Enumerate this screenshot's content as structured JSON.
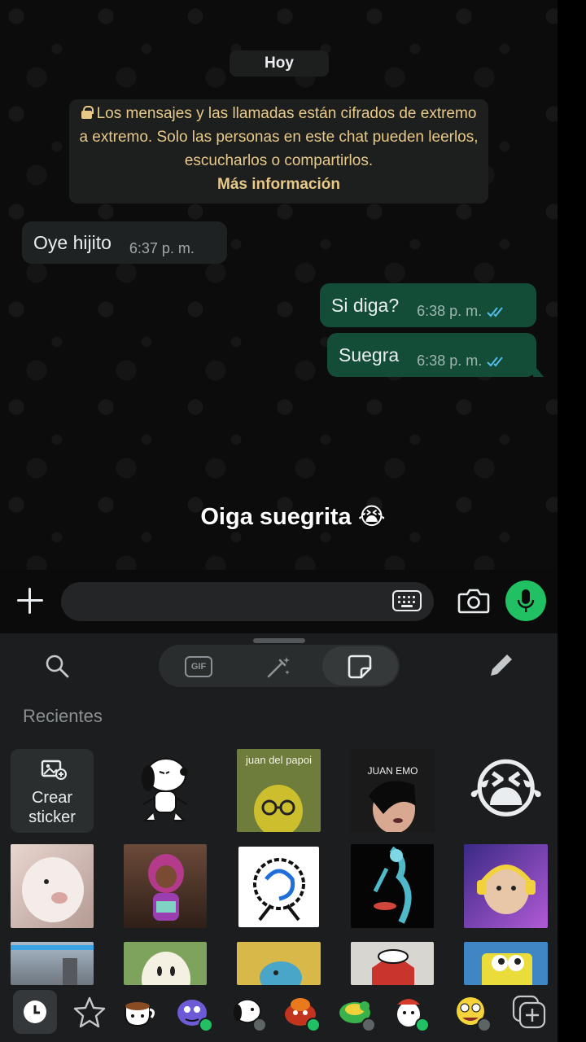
{
  "chat": {
    "date_chip": "Hoy",
    "encryption_notice": "Los mensajes y las llamadas están cifrados de extremo a extremo. Solo las personas en este chat pueden leerlos, escucharlos o compartirlos.",
    "encryption_more": "Más información",
    "messages": [
      {
        "direction": "incoming",
        "text": "Oye hijito",
        "time": "6:37 p. m."
      },
      {
        "direction": "outgoing",
        "text": "Si diga?",
        "time": "6:38 p. m.",
        "status": "read"
      },
      {
        "direction": "outgoing",
        "text": "Suegra",
        "time": "6:38 p. m.",
        "status": "read"
      }
    ]
  },
  "caption": "Oiga suegrita 😭",
  "input_bar": {
    "placeholder": "",
    "icons": [
      "plus-icon",
      "keyboard-icon",
      "camera-icon",
      "microphone-icon"
    ]
  },
  "sticker_panel": {
    "tabs": [
      "GIF",
      "avatar",
      "sticker"
    ],
    "active_tab": "sticker",
    "section_label": "Recientes",
    "create_sticker_label": "Crear sticker",
    "stickers": [
      {
        "id": "snoopy-sticker"
      },
      {
        "id": "juan-del-papoi-sticker",
        "text": "juan del papoi"
      },
      {
        "id": "juan-emo-sticker",
        "text": "JUAN EMO"
      },
      {
        "id": "praying-crying-emoji-sticker",
        "text": "😭"
      },
      {
        "id": "hamster-sticker"
      },
      {
        "id": "doll-sticker"
      },
      {
        "id": "spiral-face-sticker"
      },
      {
        "id": "xray-sticker"
      },
      {
        "id": "puppy-headphones-sticker"
      },
      {
        "id": "game-scene-sticker"
      },
      {
        "id": "ghost-sticker"
      },
      {
        "id": "cartoon-animal-sticker"
      },
      {
        "id": "snoopy-house-sticker"
      },
      {
        "id": "spongebob-sticker"
      }
    ],
    "bottom_tabs": [
      "recent-icon",
      "favorites-icon",
      "pack-teacup",
      "pack-purple-character",
      "pack-snoopy",
      "pack-red-creature",
      "pack-green-turtle",
      "pack-white-character",
      "pack-yellow-face",
      "add-pack-icon"
    ]
  },
  "colors": {
    "outgoing_bubble": "#134d37",
    "incoming_bubble": "#1f2223",
    "notice_text": "#e8c987",
    "accent_green": "#21c063",
    "read_ticks": "#53bdeb"
  }
}
